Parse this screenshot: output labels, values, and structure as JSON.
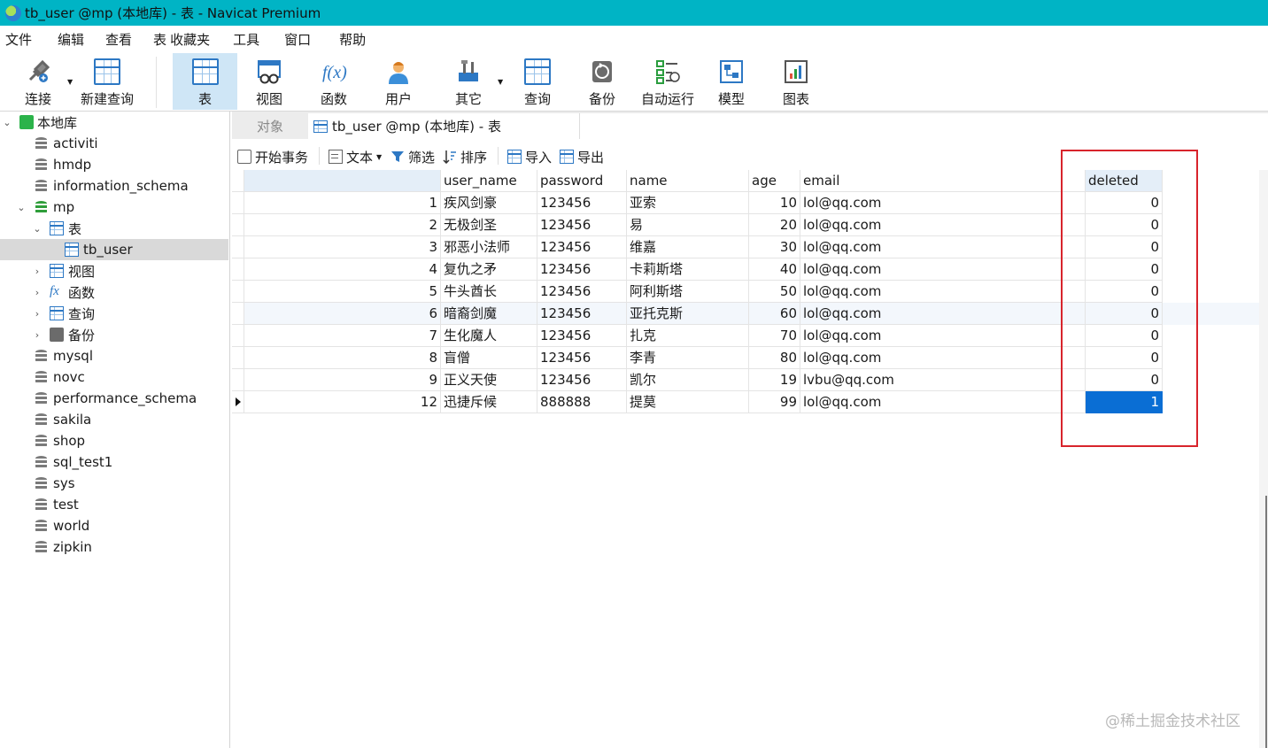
{
  "window": {
    "title": "tb_user @mp (本地库) - 表 - Navicat Premium"
  },
  "menu": [
    "文件",
    "编辑",
    "查看",
    "表",
    "收藏夹",
    "工具",
    "窗口",
    "帮助"
  ],
  "toolbar": {
    "connect": "连接",
    "new_query": "新建查询",
    "table": "表",
    "view": "视图",
    "function": "函数",
    "user": "用户",
    "other": "其它",
    "query": "查询",
    "backup": "备份",
    "autorun": "自动运行",
    "model": "模型",
    "chart": "图表"
  },
  "sidebar": {
    "connection": "本地库",
    "databases": [
      "activiti",
      "hmdp",
      "information_schema",
      "mp"
    ],
    "mp_children": {
      "tables": "表",
      "table_item": "tb_user",
      "views": "视图",
      "functions": "函数",
      "queries": "查询",
      "backups": "备份"
    },
    "more_databases": [
      "mysql",
      "novc",
      "performance_schema",
      "sakila",
      "shop",
      "sql_test1",
      "sys",
      "test",
      "world",
      "zipkin"
    ]
  },
  "tabs": {
    "objects": "对象",
    "current": "tb_user @mp (本地库) - 表"
  },
  "subtoolbar": {
    "begin_tx": "开始事务",
    "text": "文本",
    "filter": "筛选",
    "sort": "排序",
    "import": "导入",
    "export": "导出"
  },
  "grid": {
    "columns": [
      "",
      "user_name",
      "password",
      "name",
      "age",
      "email",
      "",
      "deleted"
    ],
    "rows": [
      [
        "1",
        "疾风剑豪",
        "123456",
        "亚索",
        "10",
        "lol@qq.com",
        "",
        "0"
      ],
      [
        "2",
        "无极剑圣",
        "123456",
        "易",
        "20",
        "lol@qq.com",
        "",
        "0"
      ],
      [
        "3",
        "邪恶小法师",
        "123456",
        "维嘉",
        "30",
        "lol@qq.com",
        "",
        "0"
      ],
      [
        "4",
        "复仇之矛",
        "123456",
        "卡莉斯塔",
        "40",
        "lol@qq.com",
        "",
        "0"
      ],
      [
        "5",
        "牛头酋长",
        "123456",
        "阿利斯塔",
        "50",
        "lol@qq.com",
        "",
        "0"
      ],
      [
        "6",
        "暗裔剑魔",
        "123456",
        "亚托克斯",
        "60",
        "lol@qq.com",
        "",
        "0"
      ],
      [
        "7",
        "生化魔人",
        "123456",
        "扎克",
        "70",
        "lol@qq.com",
        "",
        "0"
      ],
      [
        "8",
        "盲僧",
        "123456",
        "李青",
        "80",
        "lol@qq.com",
        "",
        "0"
      ],
      [
        "9",
        "正义天使",
        "123456",
        "凯尔",
        "19",
        "lvbu@qq.com",
        "",
        "0"
      ],
      [
        "12",
        "迅捷斥候",
        "888888",
        "提莫",
        "99",
        "lol@qq.com",
        "",
        "1"
      ]
    ]
  },
  "watermark": "@稀土掘金技术社区"
}
